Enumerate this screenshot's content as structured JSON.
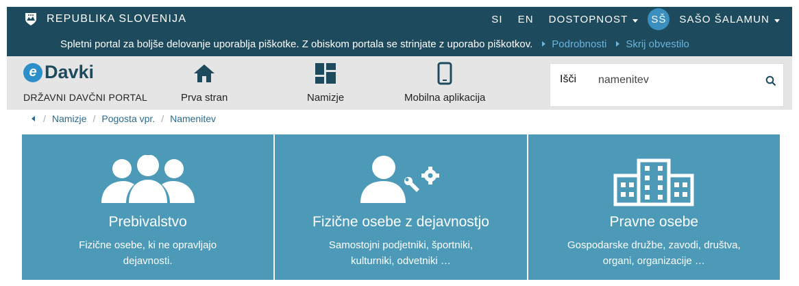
{
  "topbar": {
    "brand": "REPUBLIKA SLOVENIJA",
    "lang_si": "SI",
    "lang_en": "EN",
    "accessibility": "DOSTOPNOST",
    "user_initials": "SŠ",
    "user_name": "SAŠO ŠALAMUN"
  },
  "cookie": {
    "text": "Spletni portal za boljše delovanje uporablja piškotke. Z obiskom portala se strinjate z uporabo piškotkov.",
    "details_link": "Podrobnosti",
    "hide_link": "Skrij obvestilo"
  },
  "header": {
    "logo_letter": "e",
    "logo_word": "Davki",
    "portal_name": "DRŽAVNI DAVČNI PORTAL",
    "nav": [
      {
        "label": "Prva stran",
        "icon": "home-icon"
      },
      {
        "label": "Namizje",
        "icon": "dashboard-icon"
      },
      {
        "label": "Mobilna aplikacija",
        "icon": "mobile-icon"
      }
    ],
    "search": {
      "label": "Išči",
      "value": "namenitev"
    }
  },
  "breadcrumb": [
    "Namizje",
    "Pogosta vpr.",
    "Namenitev"
  ],
  "tiles": [
    {
      "title": "Prebivalstvo",
      "desc": "Fizične osebe, ki ne opravljajo dejavnosti.",
      "icon": "people-icon"
    },
    {
      "title": "Fizične osebe z dejavnostjo",
      "desc": "Samostojni podjetniki, športniki, kulturniki, odvetniki …",
      "icon": "person-tools-icon"
    },
    {
      "title": "Pravne osebe",
      "desc": "Gospodarske družbe, zavodi, društva, organi, organizacije …",
      "icon": "building-icon"
    }
  ],
  "colors": {
    "topbar": "#1e4a5e",
    "tile": "#4c9ab7",
    "link": "#6ab4dc",
    "avatar": "#3a8fbf"
  }
}
